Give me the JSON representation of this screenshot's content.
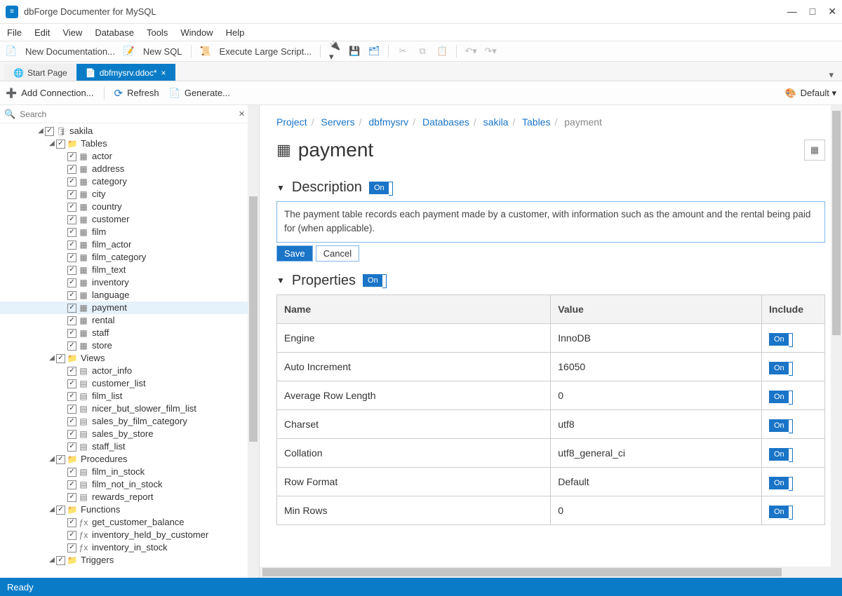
{
  "app": {
    "title": "dbForge Documenter for MySQL"
  },
  "win": {
    "min": "—",
    "max": "□",
    "close": "✕"
  },
  "menu": [
    "File",
    "Edit",
    "View",
    "Database",
    "Tools",
    "Window",
    "Help"
  ],
  "toolbar1": {
    "new_doc": "New Documentation...",
    "new_sql": "New SQL",
    "exec_large": "Execute Large Script..."
  },
  "tabs": {
    "start": "Start Page",
    "active": "dbfmysrv.ddoc*"
  },
  "toolbar2": {
    "add_conn": "Add Connection...",
    "refresh": "Refresh",
    "generate": "Generate...",
    "theme": "Default"
  },
  "search": {
    "placeholder": "Search"
  },
  "tree": {
    "database": "sakila",
    "groups": {
      "tables": "Tables",
      "views": "Views",
      "procedures": "Procedures",
      "functions": "Functions",
      "triggers": "Triggers"
    },
    "tables": [
      "actor",
      "address",
      "category",
      "city",
      "country",
      "customer",
      "film",
      "film_actor",
      "film_category",
      "film_text",
      "inventory",
      "language",
      "payment",
      "rental",
      "staff",
      "store"
    ],
    "views": [
      "actor_info",
      "customer_list",
      "film_list",
      "nicer_but_slower_film_list",
      "sales_by_film_category",
      "sales_by_store",
      "staff_list"
    ],
    "procedures": [
      "film_in_stock",
      "film_not_in_stock",
      "rewards_report"
    ],
    "functions": [
      "get_customer_balance",
      "inventory_held_by_customer",
      "inventory_in_stock"
    ],
    "selected": "payment"
  },
  "breadcrumb": [
    "Project",
    "Servers",
    "dbfmysrv",
    "Databases",
    "sakila",
    "Tables",
    "payment"
  ],
  "page": {
    "title": "payment"
  },
  "on_label": "On",
  "sections": {
    "description": {
      "heading": "Description",
      "text": "The payment table records each payment made by a customer, with information such as the amount and the rental being paid for (when applicable).",
      "save": "Save",
      "cancel": "Cancel"
    },
    "properties": {
      "heading": "Properties",
      "cols": {
        "name": "Name",
        "value": "Value",
        "include": "Include"
      },
      "rows": [
        {
          "name": "Engine",
          "value": "InnoDB"
        },
        {
          "name": "Auto Increment",
          "value": "16050"
        },
        {
          "name": "Average Row Length",
          "value": "0"
        },
        {
          "name": "Charset",
          "value": "utf8"
        },
        {
          "name": "Collation",
          "value": "utf8_general_ci"
        },
        {
          "name": "Row Format",
          "value": "Default"
        },
        {
          "name": "Min Rows",
          "value": "0"
        }
      ]
    }
  },
  "status": "Ready"
}
